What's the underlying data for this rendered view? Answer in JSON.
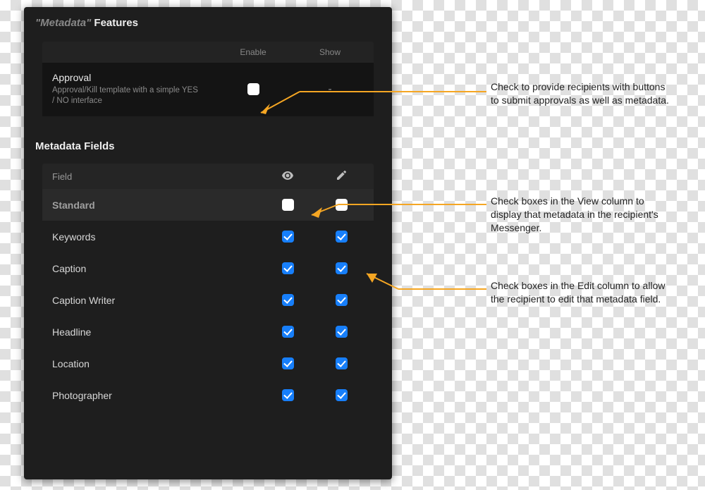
{
  "panel": {
    "features_title_prefix": "\"Metadata\"",
    "features_title_suffix": "  Features",
    "columns": {
      "enable": "Enable",
      "show": "Show"
    },
    "approval": {
      "name": "Approval",
      "desc": "Approval/Kill template with a simple YES / NO interface",
      "show_placeholder": "-"
    },
    "fields_title": "Metadata Fields",
    "fields_header_label": "Field",
    "group_label": "Standard",
    "fields": [
      {
        "label": "Keywords"
      },
      {
        "label": "Caption"
      },
      {
        "label": "Caption Writer"
      },
      {
        "label": "Headline"
      },
      {
        "label": "Location"
      },
      {
        "label": "Photographer"
      }
    ]
  },
  "callouts": {
    "enable": "Check to provide recipients with buttons to submit approvals as well as metadata.",
    "view": "Check boxes in the View column to display that metadata in the recipient's Messenger.",
    "edit": "Check boxes in the Edit column to allow the recipient to edit that metadata field."
  }
}
